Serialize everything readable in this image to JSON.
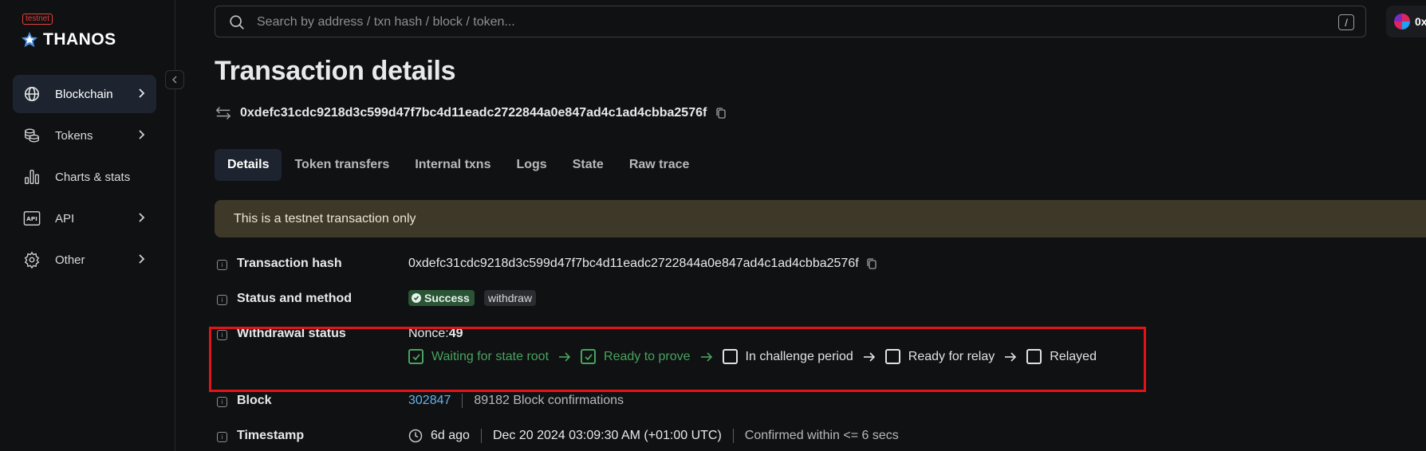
{
  "sidebar": {
    "badge": "testnet",
    "logo_text": "THANOS",
    "items": [
      {
        "label": "Blockchain",
        "icon": "globe-icon",
        "has_chevron": true,
        "active": true
      },
      {
        "label": "Tokens",
        "icon": "coins-icon",
        "has_chevron": true,
        "active": false
      },
      {
        "label": "Charts & stats",
        "icon": "bar-chart-icon",
        "has_chevron": false,
        "active": false
      },
      {
        "label": "API",
        "icon": "api-icon",
        "has_chevron": true,
        "active": false
      },
      {
        "label": "Other",
        "icon": "gear-icon",
        "has_chevron": true,
        "active": false
      }
    ]
  },
  "header": {
    "search_placeholder": "Search by address / txn hash / block / token...",
    "search_shortcut": "/",
    "account_label": "0x"
  },
  "page": {
    "title": "Transaction details",
    "tx_hash": "0xdefc31cdc9218d3c599d47f7bc4d11eadc2722844a0e847ad4c1ad4cbba2576f"
  },
  "tabs": [
    {
      "label": "Details",
      "active": true
    },
    {
      "label": "Token transfers",
      "active": false
    },
    {
      "label": "Internal txns",
      "active": false
    },
    {
      "label": "Logs",
      "active": false
    },
    {
      "label": "State",
      "active": false
    },
    {
      "label": "Raw trace",
      "active": false
    }
  ],
  "alert": {
    "text": "This is a testnet transaction only"
  },
  "details": {
    "transaction_hash": {
      "label": "Transaction hash",
      "value": "0xdefc31cdc9218d3c599d47f7bc4d11eadc2722844a0e847ad4c1ad4cbba2576f"
    },
    "status": {
      "label": "Status and method",
      "status": "Success",
      "method": "withdraw"
    },
    "withdrawal": {
      "label": "Withdrawal status",
      "nonce_label": "Nonce: ",
      "nonce": "49",
      "steps": [
        {
          "label": "Waiting for state root",
          "done": true
        },
        {
          "label": "Ready to prove",
          "done": true
        },
        {
          "label": "In challenge period",
          "done": false
        },
        {
          "label": "Ready for relay",
          "done": false
        },
        {
          "label": "Relayed",
          "done": false
        }
      ]
    },
    "block": {
      "label": "Block",
      "number": "302847",
      "confirmations": "89182 Block confirmations"
    },
    "timestamp": {
      "label": "Timestamp",
      "relative": "6d ago",
      "absolute": "Dec 20 2024 03:09:30 AM (+01:00 UTC)",
      "confirmed": "Confirmed within <= 6 secs"
    }
  },
  "colors": {
    "accent": "#63b3ed",
    "success": "#47a35f",
    "highlight": "#e1141a",
    "alert_bg": "#3d3827"
  }
}
